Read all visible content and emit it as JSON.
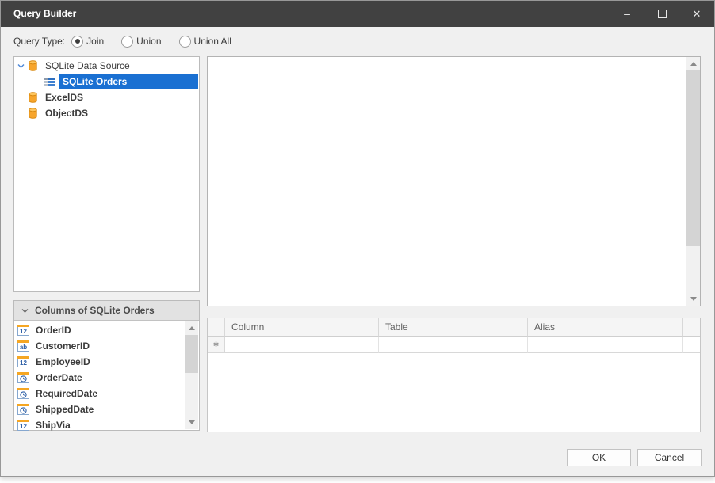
{
  "window": {
    "title": "Query Builder",
    "minimize_glyph": "–",
    "close_glyph": "✕"
  },
  "query_type": {
    "label": "Query Type:",
    "options": [
      {
        "label": "Join",
        "selected": true
      },
      {
        "label": "Union",
        "selected": false
      },
      {
        "label": "Union All",
        "selected": false
      }
    ]
  },
  "data_source_tree": {
    "items": [
      {
        "label": "SQLite Data Source",
        "icon": "database-icon",
        "expanded": true,
        "level": 0,
        "selected": false
      },
      {
        "label": "SQLite Orders",
        "icon": "table-icon",
        "level": 1,
        "selected": true
      },
      {
        "label": "ExcelDS",
        "icon": "database-icon",
        "level": 0,
        "selected": false
      },
      {
        "label": "ObjectDS",
        "icon": "database-icon",
        "level": 0,
        "selected": false
      }
    ]
  },
  "columns_panel": {
    "title": "Columns of SQLite Orders",
    "items": [
      {
        "name": "OrderID",
        "type": "numeric",
        "glyph": "12"
      },
      {
        "name": "CustomerID",
        "type": "text",
        "glyph": "ab"
      },
      {
        "name": "EmployeeID",
        "type": "numeric",
        "glyph": "12"
      },
      {
        "name": "OrderDate",
        "type": "datetime",
        "glyph": ""
      },
      {
        "name": "RequiredDate",
        "type": "datetime",
        "glyph": ""
      },
      {
        "name": "ShippedDate",
        "type": "datetime",
        "glyph": ""
      },
      {
        "name": "ShipVia",
        "type": "numeric",
        "glyph": "12"
      }
    ]
  },
  "grid": {
    "headers": [
      "Column",
      "Table",
      "Alias"
    ],
    "new_row_marker": "✱"
  },
  "footer": {
    "ok_label": "OK",
    "cancel_label": "Cancel"
  },
  "colors": {
    "titlebar": "#414141",
    "selection": "#1a70d2",
    "accent_orange": "#f5a623",
    "client_background": "#f0f0f0"
  }
}
